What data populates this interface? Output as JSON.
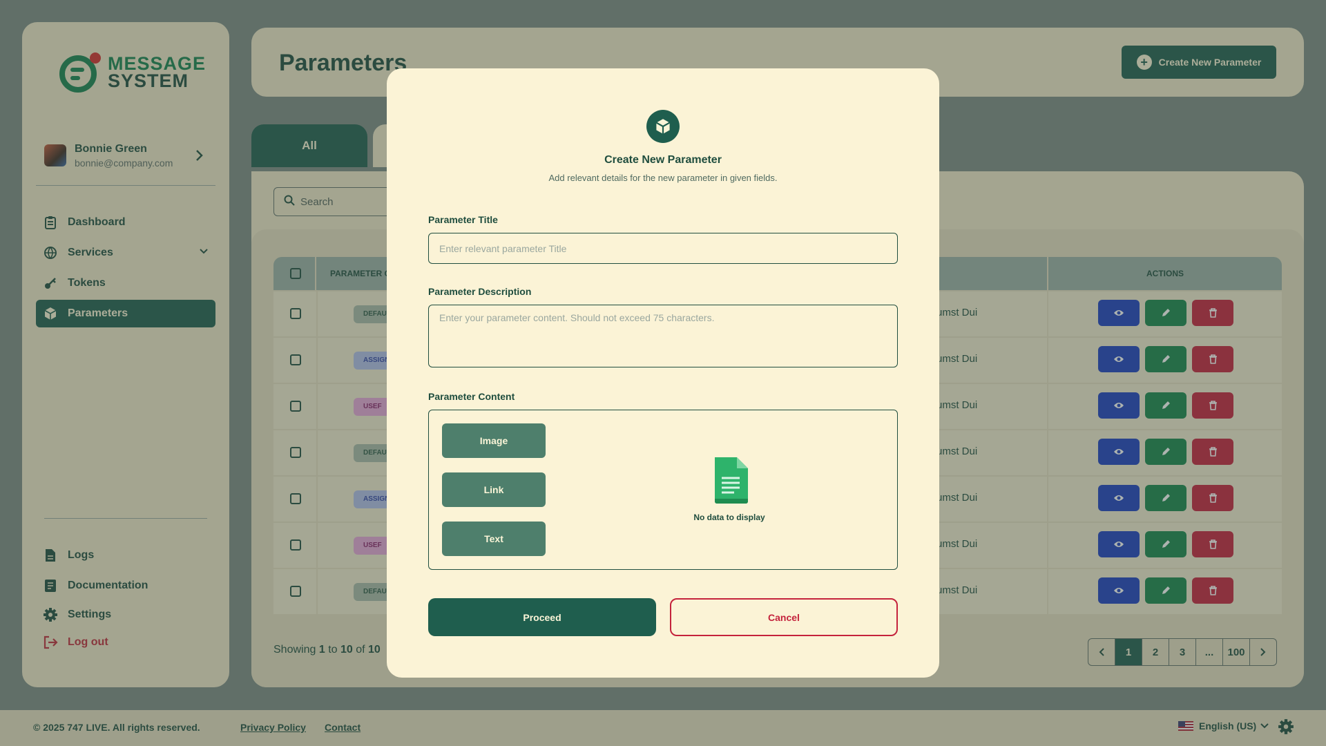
{
  "brand": {
    "line1": "MESSAGE",
    "line2": "SYSTEM"
  },
  "user": {
    "name": "Bonnie Green",
    "email": "bonnie@company.com"
  },
  "nav": {
    "dashboard": "Dashboard",
    "services": "Services",
    "tokens": "Tokens",
    "parameters": "Parameters",
    "logs": "Logs",
    "documentation": "Documentation",
    "settings": "Settings",
    "logout": "Log out"
  },
  "header": {
    "title": "Parameters",
    "create_button": "Create New Parameter"
  },
  "tabs": {
    "all": "All"
  },
  "search": {
    "placeholder": "Search"
  },
  "table": {
    "col_parameter": "PARAMETER C",
    "col_actions": "ACTIONS",
    "rows": [
      {
        "badge": "DEFAU",
        "badge_bg": "#aab9a8",
        "badge_fg": "#2f5a48",
        "desc": "umst Dui"
      },
      {
        "badge": "ASSIGN",
        "badge_bg": "#b2bde8",
        "badge_fg": "#3346a8",
        "desc": "umst Dui"
      },
      {
        "badge": "USEF",
        "badge_bg": "#e7a6d8",
        "badge_fg": "#8a1f6a",
        "desc": "umst Dui"
      },
      {
        "badge": "DEFAU",
        "badge_bg": "#aab9a8",
        "badge_fg": "#2f5a48",
        "desc": "umst Dui"
      },
      {
        "badge": "ASSIGN",
        "badge_bg": "#b2bde8",
        "badge_fg": "#3346a8",
        "desc": "umst Dui"
      },
      {
        "badge": "USEF",
        "badge_bg": "#e7a6d8",
        "badge_fg": "#8a1f6a",
        "desc": "umst Dui"
      },
      {
        "badge": "DEFAU",
        "badge_bg": "#aab9a8",
        "badge_fg": "#2f5a48",
        "desc": "umst Dui"
      }
    ]
  },
  "showing": {
    "prefix": "Showing",
    "from": "1",
    "to_word": "to",
    "to": "10",
    "of_word": "of",
    "total": "10"
  },
  "pagination": {
    "pages": [
      "1",
      "2",
      "3",
      "...",
      "100"
    ],
    "current": "1"
  },
  "modal": {
    "title": "Create New Parameter",
    "subtitle": "Add relevant details for the new parameter in given fields.",
    "title_label": "Parameter Title",
    "title_placeholder": "Enter relevant parameter Title",
    "desc_label": "Parameter Description",
    "desc_placeholder": "Enter your parameter content. Should not exceed 75 characters.",
    "content_label": "Parameter Content",
    "content_types": [
      "Image",
      "Link",
      "Text"
    ],
    "empty_text": "No data to display",
    "proceed": "Proceed",
    "cancel": "Cancel"
  },
  "footer": {
    "copyright": "© 2025 747 LIVE. All rights reserved.",
    "privacy": "Privacy Policy",
    "contact": "Contact",
    "language": "English (US)"
  },
  "colors": {
    "primary": "#1f5e4e",
    "accent_green": "#17824f",
    "danger": "#c4223c",
    "view_blue": "#1c3fbf"
  }
}
